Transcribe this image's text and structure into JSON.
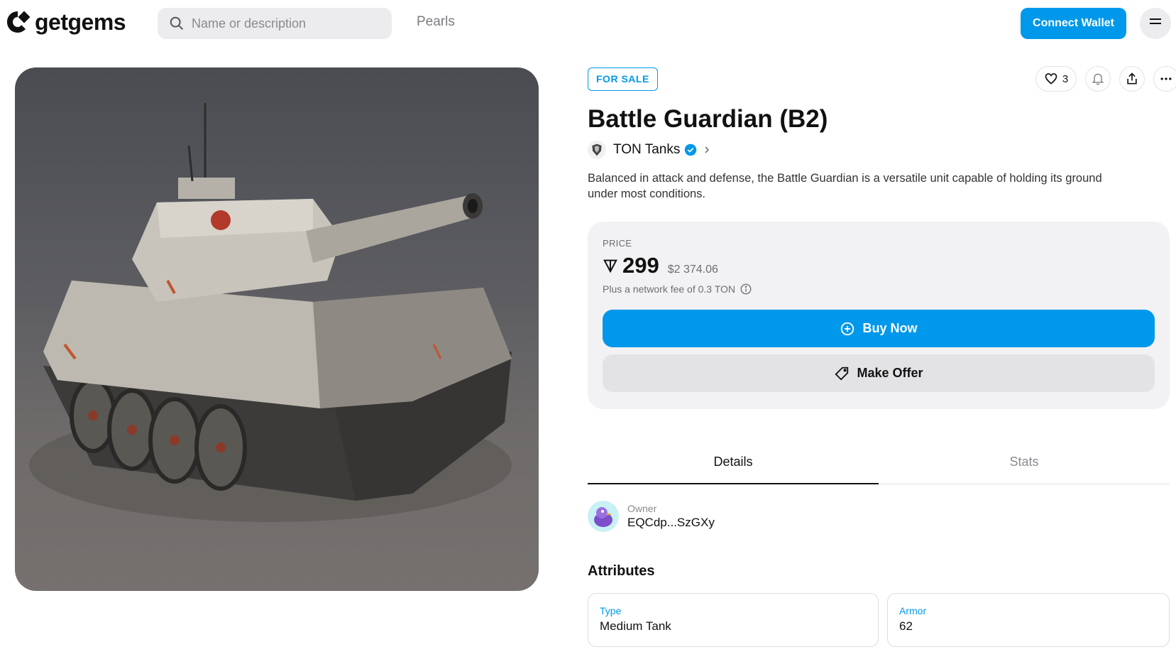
{
  "header": {
    "brand": "getgems",
    "search_placeholder": "Name or description",
    "nav_pearls": "Pearls",
    "connect_wallet": "Connect Wallet"
  },
  "item": {
    "status_badge": "FOR SALE",
    "likes": "3",
    "title": "Battle Guardian (B2)",
    "collection": "TON Tanks",
    "description": "Balanced in attack and defense, the Battle Guardian is a versatile unit capable of holding its ground under most conditions."
  },
  "price": {
    "label": "PRICE",
    "value": "299",
    "usd": "$2 374.06",
    "fee_note": "Plus a network fee of 0.3 TON",
    "buy_label": "Buy Now",
    "offer_label": "Make Offer"
  },
  "tabs": [
    "Details",
    "Stats"
  ],
  "owner": {
    "label": "Owner",
    "address": "EQCdp...SzGXy"
  },
  "attributes": {
    "title": "Attributes",
    "items": [
      {
        "key": "Type",
        "value": "Medium Tank"
      },
      {
        "key": "Armor",
        "value": "62"
      }
    ]
  },
  "colors": {
    "accent": "#0098ea",
    "card_bg": "#f2f2f4"
  }
}
